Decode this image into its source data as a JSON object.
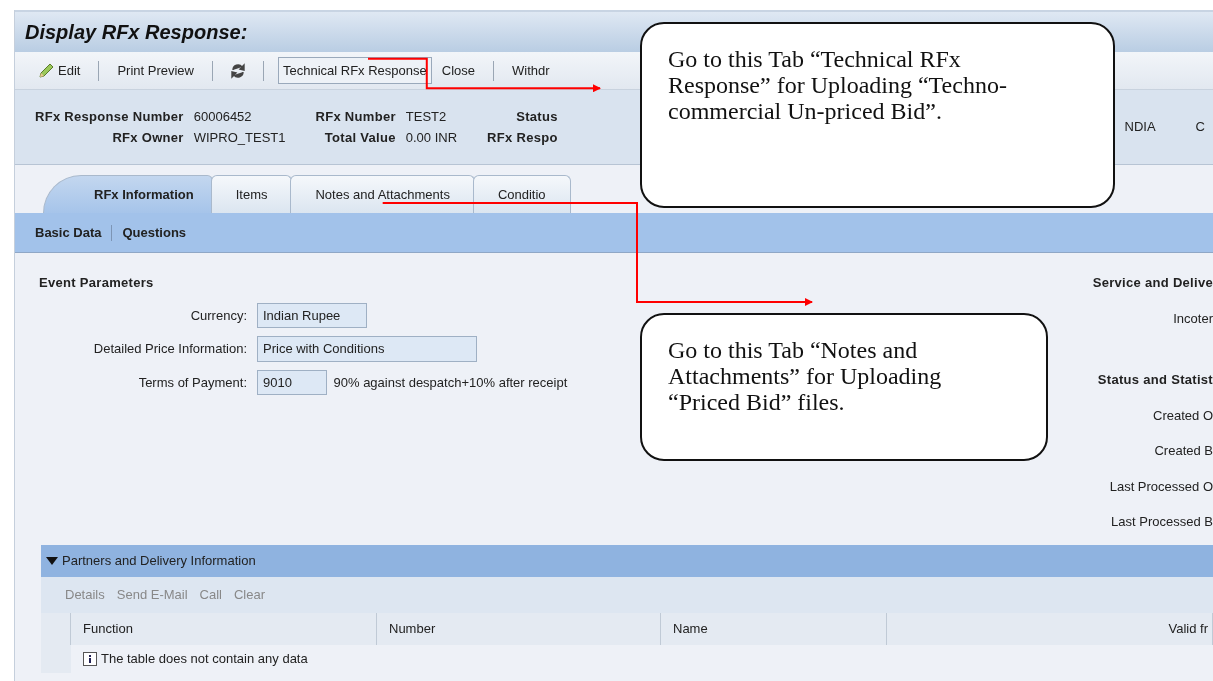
{
  "title": "Display RFx Response:",
  "toolbar": [
    {
      "kind": "pencil",
      "label": "Edit"
    },
    {
      "kind": "text",
      "label": "Print Preview"
    },
    {
      "kind": "refresh"
    },
    {
      "kind": "framed",
      "label": "Technical RFx Response"
    },
    {
      "kind": "text",
      "label": "Close"
    },
    {
      "kind": "text",
      "label": "Withdr"
    }
  ],
  "header": {
    "groups": [
      {
        "fields": [
          {
            "label": "RFx Response Number",
            "value": "60006452"
          },
          {
            "label": "RFx Owner",
            "value": "WIPRO_TEST1"
          }
        ]
      },
      {
        "fields": [
          {
            "label": "RFx Number",
            "value": "TEST2"
          },
          {
            "label": "Total Value",
            "value": "0.00 INR"
          }
        ]
      },
      {
        "fields": [
          {
            "label": "Status"
          },
          {
            "label": "RFx Respo"
          }
        ]
      }
    ],
    "fragments": [
      "NDIA",
      "C"
    ]
  },
  "tabs": [
    {
      "label": "RFx Information",
      "selected": true
    },
    {
      "label": "Items",
      "selected": false
    },
    {
      "label": "Notes and Attachments",
      "selected": false
    },
    {
      "label": "Conditio",
      "selected": false
    }
  ],
  "subtabs": [
    "Basic Data",
    "Questions"
  ],
  "event_parameters": {
    "heading": "Event Parameters",
    "fields": [
      {
        "label": "Currency:",
        "value": "Indian Rupee"
      },
      {
        "label": "Detailed Price Information:",
        "value": "Price with Conditions"
      },
      {
        "label": "Terms of Payment:",
        "value": "9010",
        "description": "90% against despatch+10% after receipt"
      }
    ]
  },
  "right_panel": [
    {
      "kind": "heading",
      "text": "Service and Delive"
    },
    {
      "kind": "label",
      "text": "Incoter"
    },
    {
      "kind": "heading",
      "text": "Status and Statist"
    },
    {
      "kind": "label",
      "text": "Created O"
    },
    {
      "kind": "label",
      "text": "Created B"
    },
    {
      "kind": "label",
      "text": "Last Processed O"
    },
    {
      "kind": "label",
      "text": "Last Processed B"
    }
  ],
  "partners": {
    "title": "Partners and Delivery Information",
    "expanded": true,
    "actions": [
      {
        "label": "Details",
        "disabled": true
      },
      {
        "label": "Send E-Mail",
        "disabled": true
      },
      {
        "label": "Call",
        "disabled": true
      },
      {
        "label": "Clear",
        "disabled": true
      }
    ],
    "columns": [
      "Function",
      "Number",
      "Name",
      "Valid fr"
    ],
    "empty_message": "The table does not contain any data"
  },
  "callouts": [
    {
      "text": "Go to this Tab “Technical RFx Response” for Uploading “Techno-commercial Un-priced Bid”."
    },
    {
      "text": "Go to this Tab “Notes and Attachments” for Uploading “Priced Bid” files."
    }
  ]
}
